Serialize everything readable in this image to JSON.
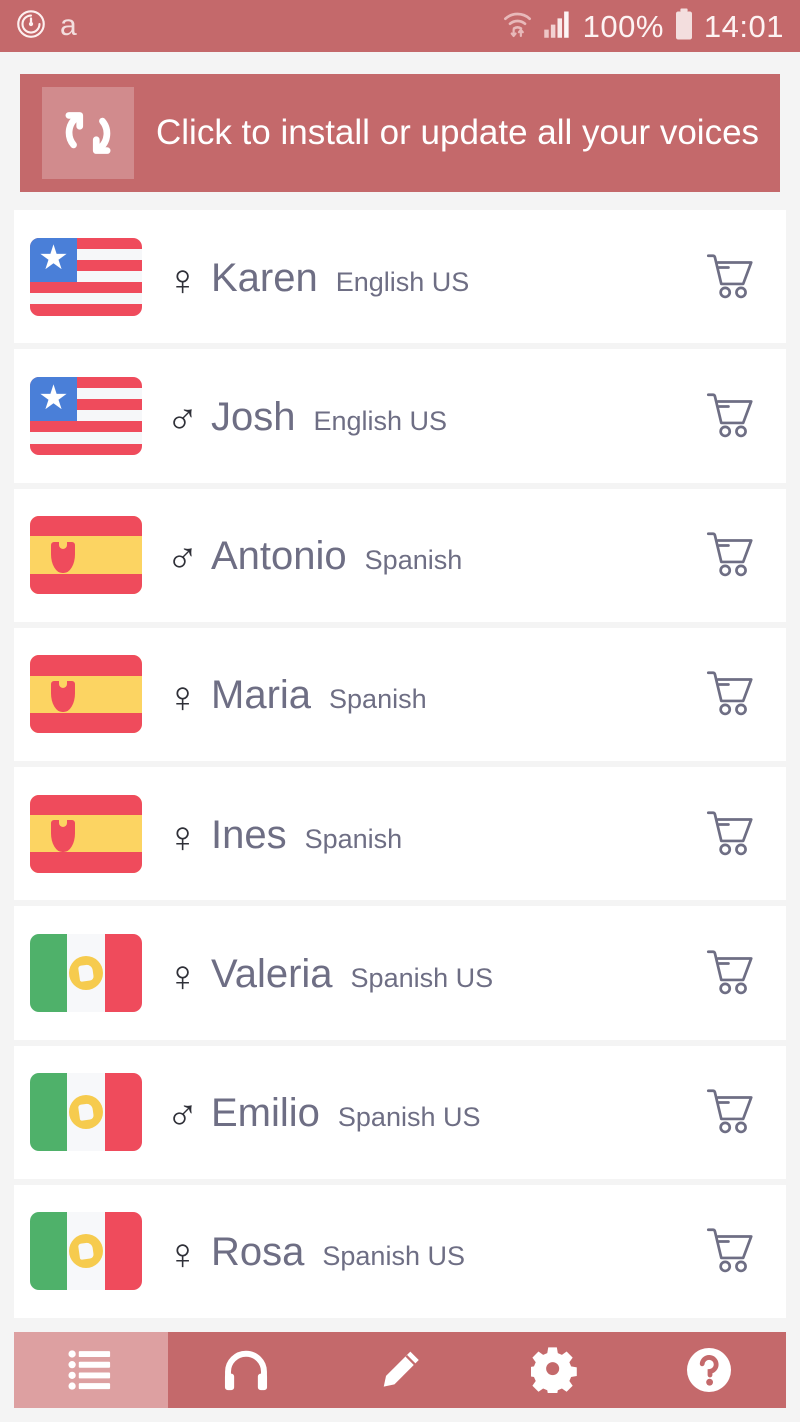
{
  "status_bar": {
    "app_icon": "alarm-circle-icon",
    "app_letter": "a",
    "wifi_icon": "wifi-transfer-icon",
    "signal_icon": "signal-bars-icon",
    "battery_percent": "100%",
    "battery_icon": "battery-full-icon",
    "time": "14:01",
    "background_color": "#c4696b"
  },
  "banner": {
    "icon": "sync-refresh-icon",
    "label": "Click to install or update all your voices",
    "background_color": "#c4696b"
  },
  "voices": [
    {
      "flag": "us",
      "flag_name": "flag-united-states",
      "gender_symbol": "♀",
      "gender": "female",
      "name": "Karen",
      "language": "English US",
      "action_icon": "shopping-cart-icon"
    },
    {
      "flag": "us",
      "flag_name": "flag-united-states",
      "gender_symbol": "♂",
      "gender": "male",
      "name": "Josh",
      "language": "English US",
      "action_icon": "shopping-cart-icon"
    },
    {
      "flag": "es",
      "flag_name": "flag-spain",
      "gender_symbol": "♂",
      "gender": "male",
      "name": "Antonio",
      "language": "Spanish",
      "action_icon": "shopping-cart-icon"
    },
    {
      "flag": "es",
      "flag_name": "flag-spain",
      "gender_symbol": "♀",
      "gender": "female",
      "name": "Maria",
      "language": "Spanish",
      "action_icon": "shopping-cart-icon"
    },
    {
      "flag": "es",
      "flag_name": "flag-spain",
      "gender_symbol": "♀",
      "gender": "female",
      "name": "Ines",
      "language": "Spanish",
      "action_icon": "shopping-cart-icon"
    },
    {
      "flag": "mx",
      "flag_name": "flag-mexico",
      "gender_symbol": "♀",
      "gender": "female",
      "name": "Valeria",
      "language": "Spanish US",
      "action_icon": "shopping-cart-icon"
    },
    {
      "flag": "mx",
      "flag_name": "flag-mexico",
      "gender_symbol": "♂",
      "gender": "male",
      "name": "Emilio",
      "language": "Spanish US",
      "action_icon": "shopping-cart-icon"
    },
    {
      "flag": "mx",
      "flag_name": "flag-mexico",
      "gender_symbol": "♀",
      "gender": "female",
      "name": "Rosa",
      "language": "Spanish US",
      "action_icon": "shopping-cart-icon"
    }
  ],
  "bottom_nav": {
    "background_color": "#c4696b",
    "active_color": "#dda0a1",
    "items": [
      {
        "icon": "list-icon",
        "name": "voices",
        "active": true
      },
      {
        "icon": "headphones-icon",
        "name": "listen",
        "active": false
      },
      {
        "icon": "pencil-icon",
        "name": "edit",
        "active": false
      },
      {
        "icon": "gear-icon",
        "name": "settings",
        "active": false
      },
      {
        "icon": "help-icon",
        "name": "help",
        "active": false
      }
    ]
  },
  "theme": {
    "accent": "#c4696b",
    "page_background": "#f4f4f4",
    "card_background": "#ffffff",
    "text_primary": "#6e6e84",
    "flag_red": "#ef4b5c",
    "flag_blue": "#4a7fd8",
    "flag_yellow": "#fcd462",
    "flag_green": "#4fb16a"
  }
}
